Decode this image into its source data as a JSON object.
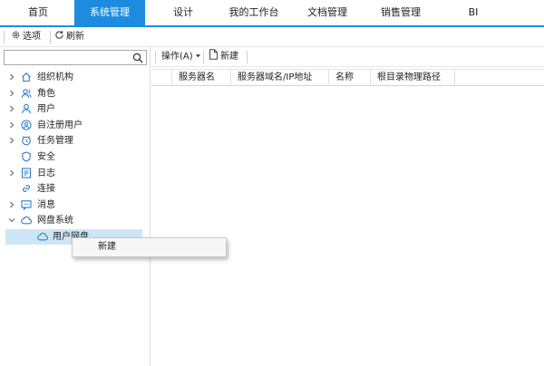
{
  "tabs": [
    {
      "label": "首页"
    },
    {
      "label": "系统管理"
    },
    {
      "label": "设计"
    },
    {
      "label": "我的工作台"
    },
    {
      "label": "文档管理"
    },
    {
      "label": "销售管理"
    },
    {
      "label": "BI"
    }
  ],
  "toolbar": {
    "options_label": "选项",
    "refresh_label": "刷新"
  },
  "search": {
    "value": "",
    "placeholder": ""
  },
  "tree": [
    {
      "label": "组织机构",
      "icon": "home-icon",
      "expandable": true
    },
    {
      "label": "角色",
      "icon": "role-icon",
      "expandable": true
    },
    {
      "label": "用户",
      "icon": "user-icon",
      "expandable": true
    },
    {
      "label": "自注册用户",
      "icon": "user-circle-icon",
      "expandable": true
    },
    {
      "label": "任务管理",
      "icon": "clock-icon",
      "expandable": true
    },
    {
      "label": "安全",
      "icon": "shield-icon",
      "expandable": false
    },
    {
      "label": "日志",
      "icon": "log-icon",
      "expandable": true
    },
    {
      "label": "连接",
      "icon": "link-icon",
      "expandable": false
    },
    {
      "label": "消息",
      "icon": "message-icon",
      "expandable": true
    },
    {
      "label": "网盘系统",
      "icon": "cloud-icon",
      "expandable": true,
      "expanded": true
    },
    {
      "label": "用户网盘",
      "icon": "cloud-icon",
      "expandable": false,
      "child": true,
      "selected": true
    }
  ],
  "right_toolbar": {
    "operate_label": "操作(A)",
    "new_label": "新建"
  },
  "grid": {
    "columns": [
      "服务器名",
      "服务器域名/IP地址",
      "名称",
      "根目录物理路径"
    ]
  },
  "context_menu": {
    "items": [
      "新建"
    ]
  },
  "colors": {
    "accent": "#1d8ce0",
    "selected_row": "#cde6f7",
    "icon_blue": "#2f7dc8"
  }
}
